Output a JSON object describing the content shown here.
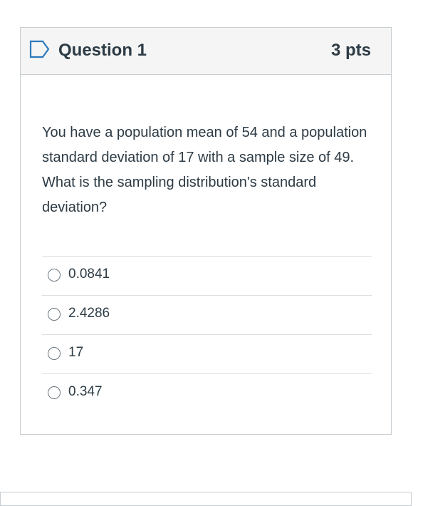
{
  "question": {
    "title": "Question 1",
    "points": "3 pts",
    "flag_icon": "flag-bookmark-icon",
    "text": "You have a population mean of 54 and a population standard deviation of 17 with a sample size of 49.  What is the sampling distribution's standard deviation?",
    "answers": [
      {
        "label": "0.0841",
        "selected": false
      },
      {
        "label": "2.4286",
        "selected": false
      },
      {
        "label": "17",
        "selected": false
      },
      {
        "label": "0.347",
        "selected": false
      }
    ]
  },
  "colors": {
    "text": "#2d3b45",
    "header_bg": "#f5f5f5",
    "border": "#c7cdd1",
    "flag": "#2b7abc"
  }
}
